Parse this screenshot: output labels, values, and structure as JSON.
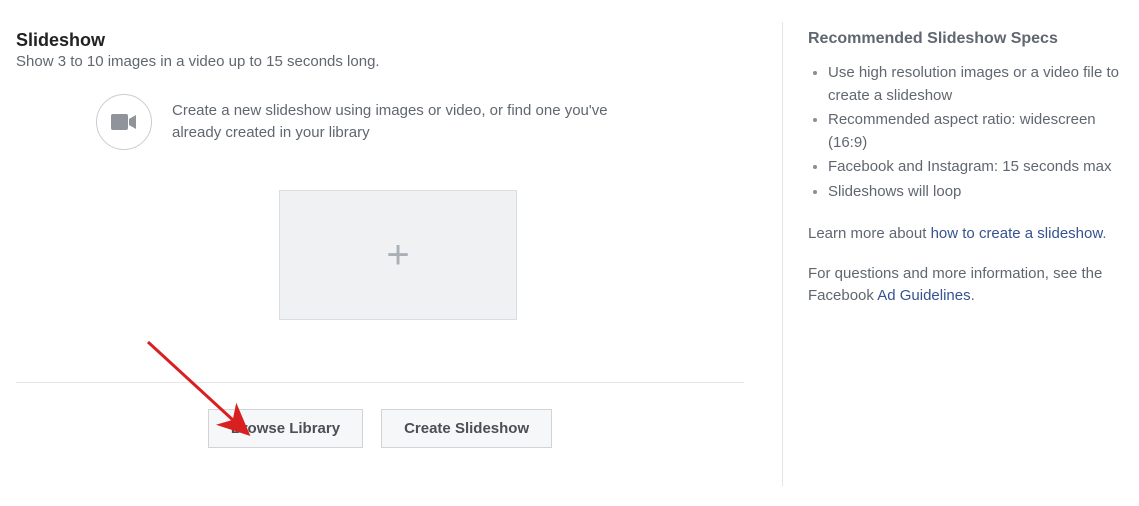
{
  "main": {
    "heading": "Slideshow",
    "subheading": "Show 3 to 10 images in a video up to 15 seconds long.",
    "tip_text": "Create a new slideshow using images or video, or find one you've already created in your library",
    "buttons": {
      "browse_library": "Browse Library",
      "create_slideshow": "Create Slideshow"
    }
  },
  "right": {
    "specs_title": "Recommended Slideshow Specs",
    "specs": [
      "Use high resolution images or a video file to create a slideshow",
      "Recommended aspect ratio: widescreen (16:9)",
      "Facebook and Instagram: 15 seconds max",
      "Slideshows will loop"
    ],
    "learn_prefix": "Learn more about ",
    "learn_link": "how to create a slideshow",
    "learn_suffix": ".",
    "questions_prefix": "For questions and more information, see the Facebook ",
    "questions_link": "Ad Guidelines",
    "questions_suffix": "."
  }
}
